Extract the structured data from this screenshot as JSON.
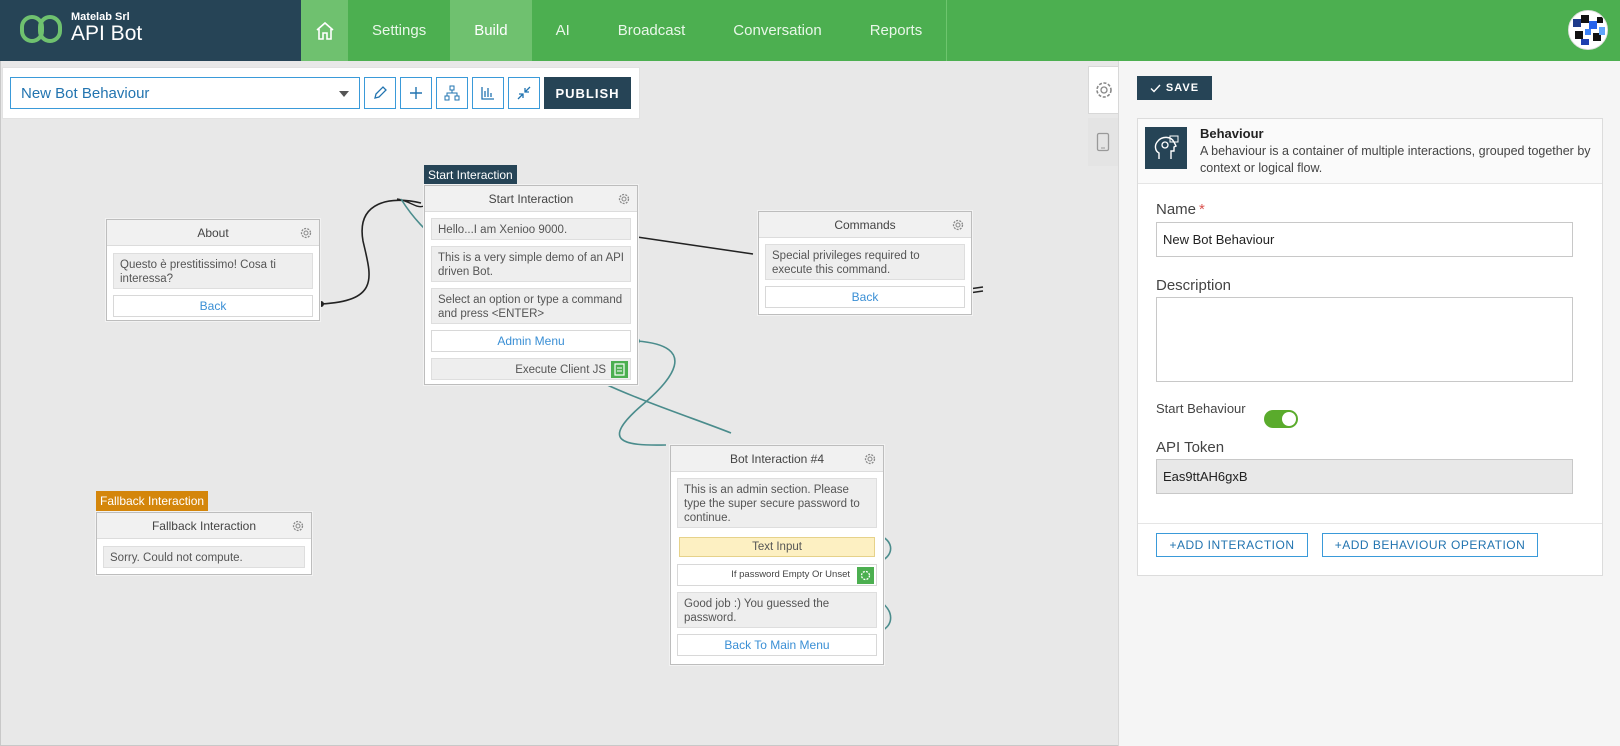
{
  "brand": {
    "company": "Matelab Srl",
    "product": "API Bot"
  },
  "nav": {
    "items": [
      "Settings",
      "Build",
      "AI",
      "Broadcast",
      "Conversation",
      "Reports"
    ],
    "active": "Build"
  },
  "toolbar": {
    "behaviour_select": "New Bot Behaviour",
    "publish_label": "PUBLISH"
  },
  "nodes": {
    "about": {
      "title": "About",
      "message": "Questo è prestitissimo! Cosa ti interessa?",
      "link": "Back"
    },
    "start": {
      "tag": "Start Interaction",
      "title": "Start Interaction",
      "messages": [
        "Hello...I am Xenioo 9000.",
        "This is a very simple demo of an API driven Bot.",
        "Select an option or type a command and press <ENTER>"
      ],
      "link": "Admin Menu",
      "action": "Execute Client JS"
    },
    "commands": {
      "title": "Commands",
      "message": "Special privileges required to execute this command.",
      "link": "Back"
    },
    "fallback": {
      "tag": "Fallback Interaction",
      "title": "Fallback Interaction",
      "message": "Sorry. Could not compute."
    },
    "bot4": {
      "title": "Bot Interaction #4",
      "message1": "This is an admin section. Please type the super secure password to continue.",
      "text_input": "Text Input",
      "condition": "If password Empty Or Unset",
      "message2": "Good job :) You guessed the password.",
      "link": "Back To Main Menu"
    }
  },
  "panel": {
    "save_label": "SAVE",
    "card_title": "Behaviour",
    "card_desc": "A behaviour is a container of multiple interactions, grouped together by context or logical flow.",
    "name_label": "Name",
    "name_required": "*",
    "name_value": "New Bot Behaviour",
    "description_label": "Description",
    "description_value": "",
    "start_label": "Start Behaviour",
    "start_on": true,
    "token_label": "API Token",
    "token_value": "Eas9ttAH6gxB",
    "add_interaction": "+ADD INTERACTION",
    "add_operation": "+ADD BEHAVIOUR OPERATION"
  },
  "colors": {
    "header": "#4caf50",
    "brand_bg": "#264456",
    "start_tag": "#264456",
    "fallback_tag": "#d4860b",
    "link": "#3a8fd5",
    "toggle_on": "#5aab2c",
    "connector_teal": "#4a8c8c"
  },
  "icons": [
    "home-icon",
    "pencil-icon",
    "plus-icon",
    "hierarchy-icon",
    "chart-icon",
    "collapse-icon",
    "gear-icon",
    "mobile-icon",
    "check-icon",
    "behaviour-icon",
    "script-icon",
    "condition-icon"
  ]
}
